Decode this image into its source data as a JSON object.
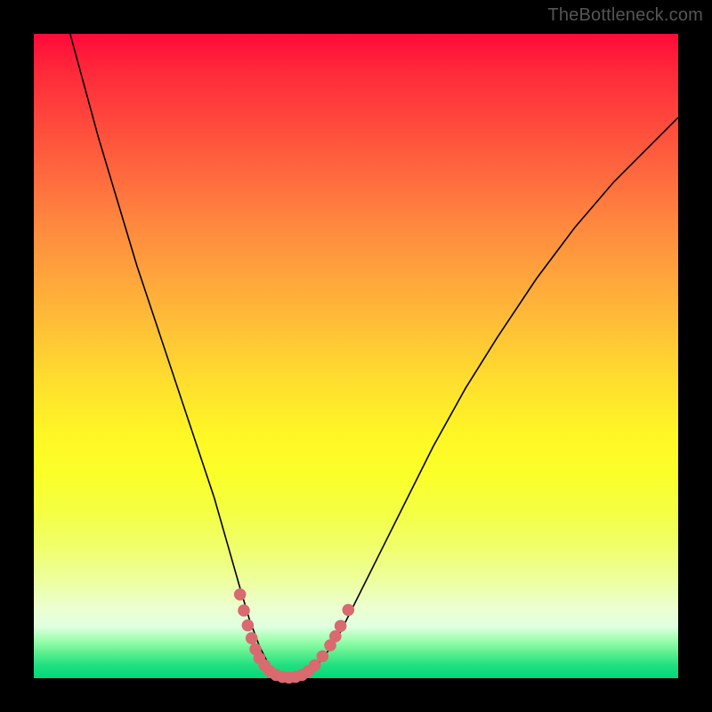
{
  "watermark": "TheBottleneck.com",
  "chart_data": {
    "type": "line",
    "title": "",
    "xlabel": "",
    "ylabel": "",
    "xlim": [
      0,
      100
    ],
    "ylim": [
      0,
      100
    ],
    "grid": false,
    "legend": false,
    "series": [
      {
        "name": "bottleneck-curve",
        "x": [
          4,
          7,
          10,
          13,
          16,
          19,
          22,
          25,
          28,
          30,
          32,
          33.5,
          35,
          36.5,
          38,
          40,
          42,
          44,
          47,
          50,
          54,
          58,
          62,
          67,
          72,
          78,
          84,
          90,
          96,
          100
        ],
        "y": [
          106,
          95,
          84,
          74,
          64,
          55,
          46,
          37,
          28,
          21,
          14,
          9,
          5,
          2,
          0.5,
          0,
          0.5,
          2,
          6,
          12,
          20,
          28,
          36,
          45,
          53,
          62,
          70,
          77,
          83,
          87
        ]
      }
    ],
    "markers": {
      "name": "highlight-dots",
      "color": "#d96a6f",
      "points": [
        {
          "x": 32.0,
          "y": 13
        },
        {
          "x": 32.6,
          "y": 10.5
        },
        {
          "x": 33.2,
          "y": 8.2
        },
        {
          "x": 33.8,
          "y": 6.2
        },
        {
          "x": 34.4,
          "y": 4.5
        },
        {
          "x": 35.0,
          "y": 3.1
        },
        {
          "x": 35.8,
          "y": 2.0
        },
        {
          "x": 36.6,
          "y": 1.1
        },
        {
          "x": 37.6,
          "y": 0.5
        },
        {
          "x": 38.6,
          "y": 0.2
        },
        {
          "x": 39.6,
          "y": 0.1
        },
        {
          "x": 40.6,
          "y": 0.2
        },
        {
          "x": 41.6,
          "y": 0.5
        },
        {
          "x": 42.6,
          "y": 1.1
        },
        {
          "x": 43.6,
          "y": 2.0
        },
        {
          "x": 44.8,
          "y": 3.4
        },
        {
          "x": 46.0,
          "y": 5.1
        },
        {
          "x": 46.8,
          "y": 6.5
        },
        {
          "x": 47.6,
          "y": 8.1
        },
        {
          "x": 48.8,
          "y": 10.6
        }
      ]
    }
  }
}
